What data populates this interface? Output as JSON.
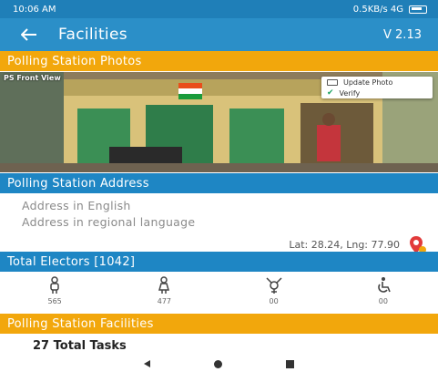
{
  "status_bar": {
    "time": "10:06 AM",
    "network": "0.5KB/s 4G"
  },
  "app_bar": {
    "title": "Facilities",
    "version": "V 2.13"
  },
  "photos_section": {
    "title": "Polling Station Photos",
    "caption": "PS Front View",
    "menu": {
      "update_label": "Update Photo",
      "verify_label": "Verify"
    }
  },
  "address_section": {
    "title": "Polling Station Address",
    "english": "Address in English",
    "regional": "Address in regional language",
    "latlng": "Lat: 28.24, Lng: 77.90"
  },
  "electors": {
    "title": "Total Electors [1042]",
    "stats": [
      {
        "icon": "male-icon",
        "value": "565"
      },
      {
        "icon": "female-icon",
        "value": "477"
      },
      {
        "icon": "transgender-icon",
        "value": "00"
      },
      {
        "icon": "wheelchair-icon",
        "value": "00"
      }
    ]
  },
  "facilities": {
    "title": "Polling Station Facilities",
    "tasks": "27 Total Tasks"
  },
  "colors": {
    "primary": "#2b8fc8",
    "accent": "#f2a70c",
    "status": "#1f7fb8"
  }
}
